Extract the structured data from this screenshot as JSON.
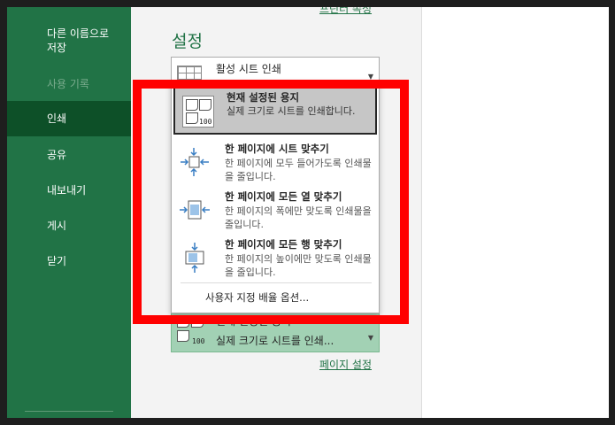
{
  "sidebar": {
    "items": [
      {
        "label": "다른 이름으로\n저장",
        "state": "normal"
      },
      {
        "label": "사용 기록",
        "state": "disabled"
      },
      {
        "label": "인쇄",
        "state": "active"
      },
      {
        "label": "공유",
        "state": "normal"
      },
      {
        "label": "내보내기",
        "state": "normal"
      },
      {
        "label": "게시",
        "state": "normal"
      },
      {
        "label": "닫기",
        "state": "normal"
      }
    ]
  },
  "links": {
    "printer_properties": "프린터 속성",
    "page_setup": "페이지 설정"
  },
  "settings": {
    "heading": "설정",
    "print_what": "활성 시트 인쇄",
    "scaling_selected_title": "현재 설정된 용지",
    "scaling_selected_desc": "실제 크기로 시트를 인쇄..."
  },
  "scaling_popup": {
    "options": [
      {
        "title": "현재 설정된 용지",
        "desc": "실제 크기로 시트를 인쇄합니다.",
        "icon": "actual-size-icon",
        "selected": true
      },
      {
        "title": "한 페이지에 시트 맞추기",
        "desc": "한 페이지에 모두 들어가도록 인쇄물을 줄입니다.",
        "icon": "fit-sheet-icon",
        "selected": false
      },
      {
        "title": "한 페이지에 모든 열 맞추기",
        "desc": "한 페이지의 폭에만 맞도록 인쇄물을 줄입니다.",
        "icon": "fit-columns-icon",
        "selected": false
      },
      {
        "title": "한 페이지에 모든 행 맞추기",
        "desc": "한 페이지의 높이에만 맞도록 인쇄물을 줄입니다.",
        "icon": "fit-rows-icon",
        "selected": false
      }
    ],
    "custom": "사용자 지정 배율 옵션..."
  },
  "colors": {
    "accent": "#217346",
    "sidebar_active": "#0d5028",
    "highlight": "#ff0000"
  }
}
